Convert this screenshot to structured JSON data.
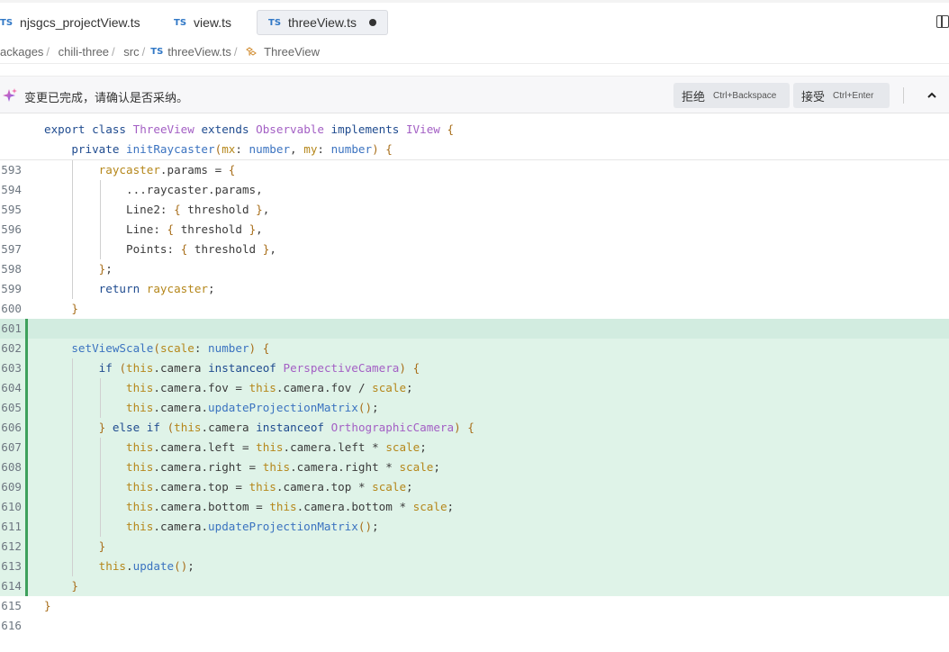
{
  "tabs": [
    {
      "icon": "TS",
      "label": "njsgcs_projectView.ts",
      "active": false
    },
    {
      "icon": "TS",
      "label": "view.ts",
      "active": false
    },
    {
      "icon": "TS",
      "label": "threeView.ts",
      "active": true,
      "modified": true
    }
  ],
  "breadcrumb": [
    "ackages",
    "chili-three",
    "src",
    "threeView.ts",
    "ThreeView"
  ],
  "breadcrumb_file_icon": "TS",
  "review": {
    "message": "变更已完成，请确认是否采纳。",
    "reject_label": "拒绝",
    "reject_shortcut": "Ctrl+Backspace",
    "accept_label": "接受",
    "accept_shortcut": "Ctrl+Enter"
  },
  "sticky_lines": [
    "export class ThreeView extends Observable implements IView {",
    "    private initRaycaster(mx: number, my: number) {"
  ],
  "code_lines": [
    {
      "num": "593",
      "text": "        raycaster.params = {"
    },
    {
      "num": "594",
      "text": "            ...raycaster.params,"
    },
    {
      "num": "595",
      "text": "            Line2: { threshold },"
    },
    {
      "num": "596",
      "text": "            Line: { threshold },"
    },
    {
      "num": "597",
      "text": "            Points: { threshold },"
    },
    {
      "num": "598",
      "text": "        };"
    },
    {
      "num": "599",
      "text": "        return raycaster;"
    },
    {
      "num": "600",
      "text": "    }"
    },
    {
      "num": "601",
      "text": ""
    },
    {
      "num": "602",
      "text": "    setViewScale(scale: number) {"
    },
    {
      "num": "603",
      "text": "        if (this.camera instanceof PerspectiveCamera) {"
    },
    {
      "num": "604",
      "text": "            this.camera.fov = this.camera.fov / scale;"
    },
    {
      "num": "605",
      "text": "            this.camera.updateProjectionMatrix();"
    },
    {
      "num": "606",
      "text": "        } else if (this.camera instanceof OrthographicCamera) {"
    },
    {
      "num": "607",
      "text": "            this.camera.left = this.camera.left * scale;"
    },
    {
      "num": "608",
      "text": "            this.camera.right = this.camera.right * scale;"
    },
    {
      "num": "609",
      "text": "            this.camera.top = this.camera.top * scale;"
    },
    {
      "num": "610",
      "text": "            this.camera.bottom = this.camera.bottom * scale;"
    },
    {
      "num": "611",
      "text": "            this.camera.updateProjectionMatrix();"
    },
    {
      "num": "612",
      "text": "        }"
    },
    {
      "num": "613",
      "text": "        this.update();"
    },
    {
      "num": "614",
      "text": "    }"
    },
    {
      "num": "615",
      "text": "}"
    },
    {
      "num": "616",
      "text": ""
    }
  ],
  "added_line_range": [
    "601",
    "614"
  ],
  "colors": {
    "added_bg": "#dff3e8",
    "added_bar": "#3ea05c",
    "ts_icon": "#3178c6",
    "keyword": "#1f4b8f",
    "class_name": "#a35fc4",
    "this_keyword": "#b5871b"
  }
}
